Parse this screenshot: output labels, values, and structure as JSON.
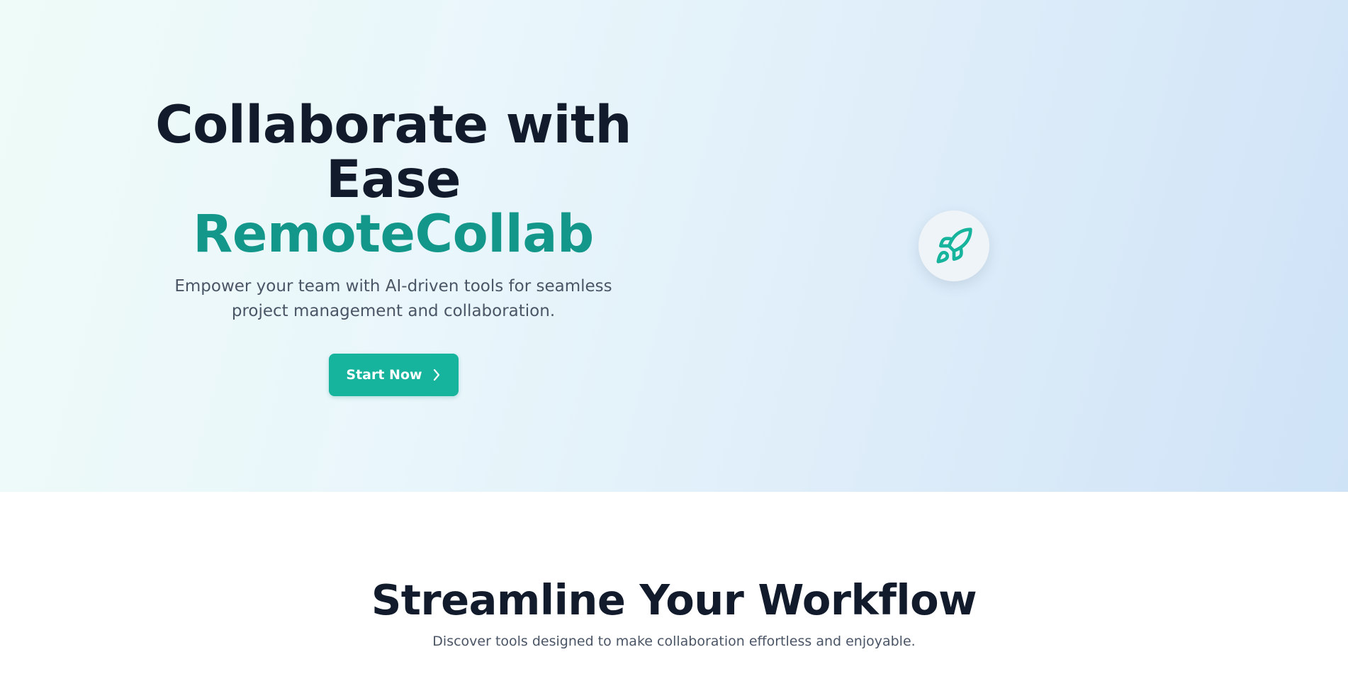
{
  "hero": {
    "title_line1": "Collaborate with",
    "title_line2": "Ease",
    "brand": "RemoteCollab",
    "subtitle": "Empower your team with AI-driven tools for seamless project management and collaboration.",
    "cta_label": "Start Now",
    "cta_icon": "chevron-right-icon",
    "badge_icon": "rocket-icon"
  },
  "features": {
    "title": "Streamline Your Workflow",
    "subtitle": "Discover tools designed to make collaboration effortless and enjoyable."
  },
  "colors": {
    "heading": "#111b2b",
    "brand": "#13978a",
    "accent": "#16b39d",
    "body_text": "#4a5566",
    "hero_gradient_start": "#effbf8",
    "hero_gradient_end": "#cfe3f7"
  }
}
